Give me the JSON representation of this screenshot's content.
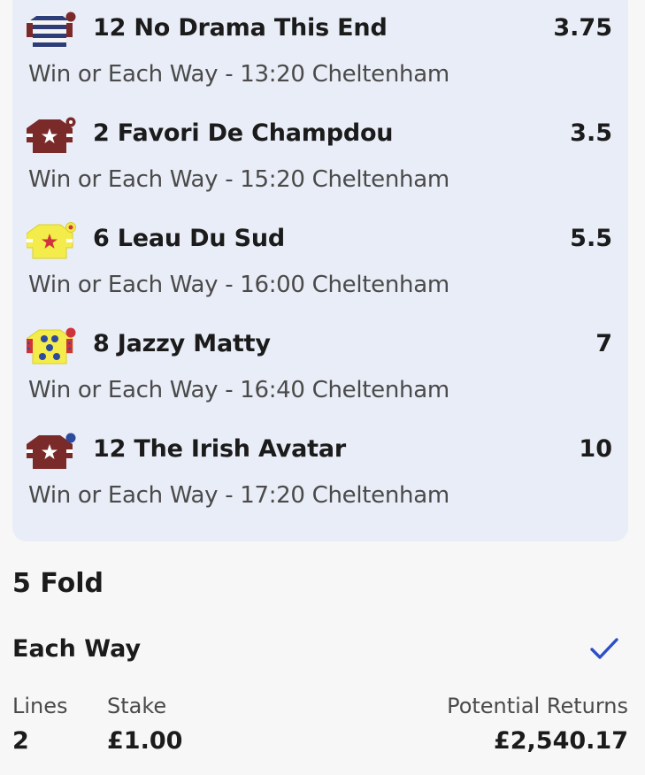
{
  "selections": [
    {
      "runner": "12 No Drama This End",
      "price": "3.75",
      "market": "Win or Each Way - 13:20 Cheltenham",
      "silks_icon": "silks-blue-white-hoops"
    },
    {
      "runner": "2 Favori De Champdou",
      "price": "3.5",
      "market": "Win or Each Way - 15:20 Cheltenham",
      "silks_icon": "silks-maroon-white-star"
    },
    {
      "runner": "6 Leau Du Sud",
      "price": "5.5",
      "market": "Win or Each Way - 16:00 Cheltenham",
      "silks_icon": "silks-yellow-red-star"
    },
    {
      "runner": "8 Jazzy Matty",
      "price": "7",
      "market": "Win or Each Way - 16:40 Cheltenham",
      "silks_icon": "silks-yellow-blue-spots"
    },
    {
      "runner": "12 The Irish Avatar",
      "price": "10",
      "market": "Win or Each Way - 17:20 Cheltenham",
      "silks_icon": "silks-maroon-white-star-blue-cap"
    }
  ],
  "bet": {
    "type": "5 Fold",
    "each_way_label": "Each Way",
    "each_way_checked": true,
    "lines_label": "Lines",
    "lines_value": "2",
    "stake_label": "Stake",
    "stake_value": "£1.00",
    "returns_label": "Potential Returns",
    "returns_value": "£2,540.17"
  },
  "colors": {
    "card_bg": "#e9edf7",
    "check": "#2c4fc6",
    "maroon": "#7b2a2a",
    "navy": "#2d3d7a",
    "yellow": "#f3ec4a",
    "red": "#d0343b",
    "blue": "#2f4a9c"
  }
}
